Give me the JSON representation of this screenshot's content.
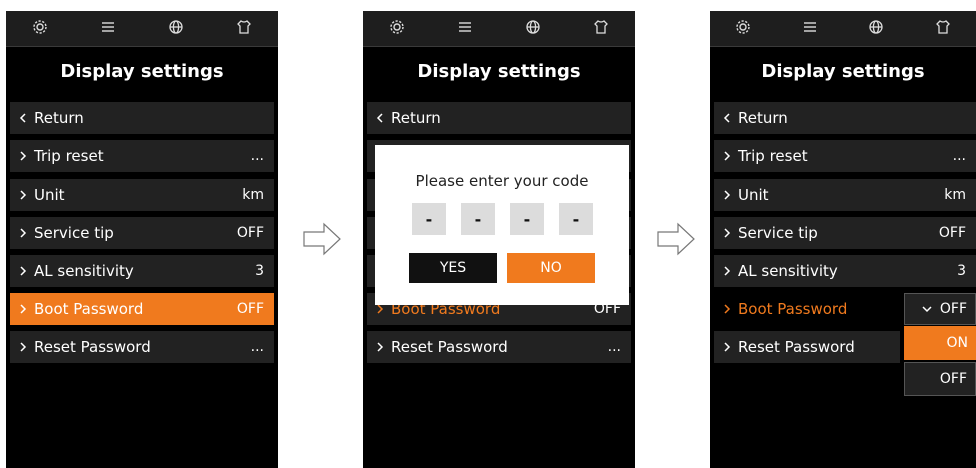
{
  "screens": [
    {
      "title": "Display settings",
      "items": [
        {
          "label": "Return",
          "value": ""
        },
        {
          "label": "Trip reset",
          "value": "..."
        },
        {
          "label": "Unit",
          "value": "km"
        },
        {
          "label": "Service tip",
          "value": "OFF"
        },
        {
          "label": "AL sensitivity",
          "value": "3"
        },
        {
          "label": "Boot Password",
          "value": "OFF"
        },
        {
          "label": "Reset Password",
          "value": "..."
        }
      ]
    },
    {
      "title": "Display settings",
      "items": [
        {
          "label": "Return",
          "value": ""
        },
        {
          "label": "Boot Password",
          "value": "OFF"
        },
        {
          "label": "Reset Password",
          "value": "..."
        }
      ],
      "dialog": {
        "prompt": "Please enter your code",
        "digits": [
          "-",
          "-",
          "-",
          "-"
        ],
        "yes_label": "YES",
        "no_label": "NO"
      }
    },
    {
      "title": "Display settings",
      "items": [
        {
          "label": "Return",
          "value": ""
        },
        {
          "label": "Trip reset",
          "value": "..."
        },
        {
          "label": "Unit",
          "value": "km"
        },
        {
          "label": "Service tip",
          "value": "OFF"
        },
        {
          "label": "AL sensitivity",
          "value": "3"
        },
        {
          "label": "Boot Password",
          "value": ""
        },
        {
          "label": "Reset Password",
          "value": ""
        }
      ],
      "dropdown": {
        "selected": "OFF",
        "options": [
          "ON",
          "OFF"
        ]
      }
    }
  ],
  "topbar_icons": [
    "gear-icon",
    "list-icon",
    "globe-icon",
    "shirt-icon"
  ],
  "colors": {
    "accent": "#f07a1e",
    "background": "#000000",
    "row": "#222222"
  }
}
